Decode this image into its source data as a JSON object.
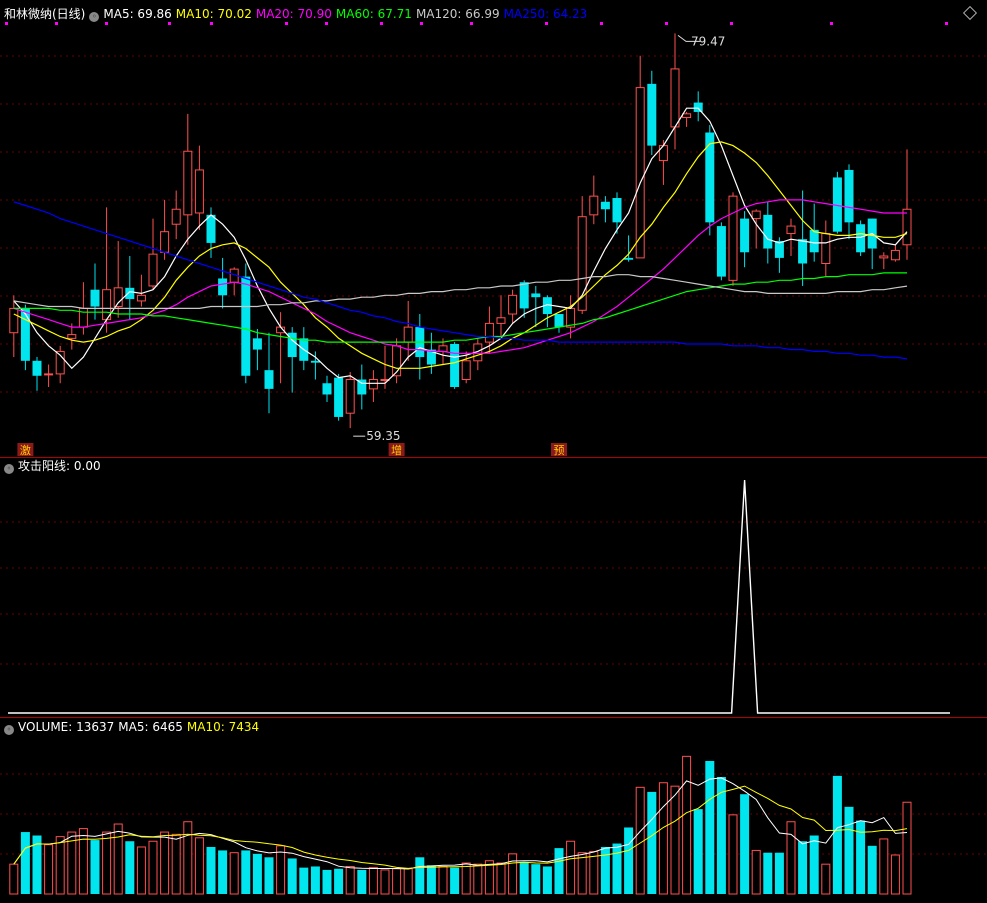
{
  "colors": {
    "up": "#ff5050",
    "down": "#00e5ee",
    "ma5": "#ffffff",
    "ma10": "#ffff00",
    "ma20": "#ff00ff",
    "ma60": "#00ff00",
    "ma120": "#c8c8c8",
    "ma250": "#0000ff",
    "signal": "#ffffff",
    "label_bg": "#8b1a1a",
    "label_fg": "#ffcc00"
  },
  "main": {
    "title": "和林微纳(日线)",
    "ma": [
      {
        "label": "MA5: 69.86",
        "color": "#ffffff"
      },
      {
        "label": "MA10: 70.02",
        "color": "#ffff00"
      },
      {
        "label": "MA20: 70.90",
        "color": "#ff00ff"
      },
      {
        "label": "MA60: 67.71",
        "color": "#00ff00"
      },
      {
        "label": "MA120: 66.99",
        "color": "#c8c8c8"
      },
      {
        "label": "MA250: 64.23",
        "color": "#0000ff"
      }
    ],
    "high_label": "79.47",
    "low_label": "59.35",
    "markers": [
      "激",
      "增",
      "预"
    ]
  },
  "indicator": {
    "title": "攻击阳线",
    "value": ": 0.00"
  },
  "volume": {
    "title": "VOLUME: 13637",
    "ma5": "MA5: 6465",
    "ma10": "MA10: 7434"
  },
  "chart_data": {
    "type": "candlestick",
    "price_range": [
      58.5,
      81.0
    ],
    "candles": [
      [
        64.5,
        65.8,
        63.2,
        66.5
      ],
      [
        65.8,
        63.0,
        62.5,
        66.0
      ],
      [
        63.0,
        62.2,
        61.4,
        63.2
      ],
      [
        62.3,
        62.3,
        61.6,
        62.8
      ],
      [
        62.3,
        63.5,
        61.8,
        63.8
      ],
      [
        64.2,
        64.4,
        63.6,
        65.0
      ],
      [
        64.8,
        65.8,
        64.4,
        67.2
      ],
      [
        66.8,
        65.9,
        65.2,
        68.2
      ],
      [
        65.2,
        66.8,
        64.5,
        71.2
      ],
      [
        65.9,
        66.9,
        65.3,
        69.4
      ],
      [
        66.9,
        66.3,
        65.2,
        68.6
      ],
      [
        66.2,
        66.5,
        65.9,
        67.6
      ],
      [
        67.0,
        68.7,
        66.8,
        70.6
      ],
      [
        68.8,
        69.9,
        68.4,
        71.6
      ],
      [
        70.3,
        71.1,
        69.5,
        72.1
      ],
      [
        70.8,
        74.2,
        69.2,
        76.2
      ],
      [
        70.9,
        73.2,
        70.0,
        74.5
      ],
      [
        70.8,
        69.3,
        68.5,
        71.2
      ],
      [
        67.4,
        66.5,
        65.8,
        68.5
      ],
      [
        67.2,
        67.9,
        66.5,
        68.0
      ],
      [
        67.5,
        62.2,
        61.8,
        68.2
      ],
      [
        64.2,
        63.6,
        62.5,
        64.7
      ],
      [
        62.5,
        61.5,
        60.2,
        64.5
      ],
      [
        64.5,
        64.8,
        61.8,
        65.6
      ],
      [
        64.5,
        63.2,
        61.3,
        64.8
      ],
      [
        64.2,
        63.0,
        62.5,
        64.8
      ],
      [
        63.0,
        62.9,
        62.0,
        63.5
      ],
      [
        61.8,
        61.2,
        60.8,
        62.2
      ],
      [
        62.1,
        60.0,
        59.8,
        62.3
      ],
      [
        60.2,
        62.0,
        59.4,
        62.4
      ],
      [
        62.0,
        61.2,
        60.4,
        62.8
      ],
      [
        61.5,
        62.0,
        60.8,
        62.5
      ],
      [
        62.0,
        62.0,
        61.5,
        63.8
      ],
      [
        62.2,
        63.8,
        61.8,
        64.2
      ],
      [
        64.0,
        64.8,
        63.0,
        66.2
      ],
      [
        64.8,
        63.2,
        62.0,
        65.5
      ],
      [
        63.6,
        62.8,
        62.3,
        64.5
      ],
      [
        63.5,
        63.8,
        62.8,
        64.2
      ],
      [
        63.9,
        61.6,
        61.5,
        64.0
      ],
      [
        62.0,
        63.0,
        61.8,
        63.5
      ],
      [
        63.0,
        63.9,
        62.5,
        64.2
      ],
      [
        64.0,
        65.0,
        63.4,
        65.9
      ],
      [
        65.0,
        65.3,
        64.3,
        66.5
      ],
      [
        65.5,
        66.5,
        65.0,
        66.8
      ],
      [
        67.2,
        65.8,
        65.3,
        67.3
      ],
      [
        66.6,
        66.4,
        64.8,
        67.0
      ],
      [
        66.4,
        65.5,
        64.8,
        66.5
      ],
      [
        65.5,
        64.8,
        64.5,
        65.5
      ],
      [
        64.8,
        65.8,
        64.2,
        66.5
      ],
      [
        65.7,
        70.7,
        65.5,
        71.8
      ],
      [
        70.8,
        71.8,
        70.3,
        72.9
      ],
      [
        71.5,
        71.1,
        70.4,
        71.8
      ],
      [
        71.7,
        70.4,
        69.8,
        72.0
      ],
      [
        68.5,
        68.4,
        68.3,
        69.7
      ],
      [
        68.5,
        77.6,
        68.5,
        79.3
      ],
      [
        77.8,
        74.5,
        74.0,
        78.5
      ],
      [
        73.7,
        74.5,
        72.4,
        74.8
      ],
      [
        75.5,
        78.6,
        74.3,
        80.5
      ],
      [
        76.0,
        76.2,
        75.5,
        76.3
      ],
      [
        76.8,
        76.3,
        75.8,
        77.4
      ],
      [
        75.2,
        70.4,
        69.7,
        75.6
      ],
      [
        70.2,
        67.5,
        67.3,
        70.4
      ],
      [
        67.3,
        71.8,
        67.0,
        72.0
      ],
      [
        70.6,
        68.8,
        68.0,
        71.0
      ],
      [
        70.6,
        71.0,
        69.0,
        71.1
      ],
      [
        70.8,
        69.0,
        68.2,
        71.5
      ],
      [
        69.4,
        68.5,
        67.7,
        69.6
      ],
      [
        69.8,
        70.2,
        68.6,
        70.6
      ],
      [
        69.5,
        68.2,
        67.0,
        72.1
      ],
      [
        70.0,
        68.8,
        68.3,
        71.4
      ],
      [
        68.2,
        69.8,
        67.5,
        70.5
      ],
      [
        72.8,
        69.9,
        69.8,
        73.1
      ],
      [
        73.2,
        70.4,
        69.5,
        73.5
      ],
      [
        70.3,
        68.8,
        68.6,
        70.5
      ],
      [
        70.6,
        69.0,
        67.9,
        70.6
      ],
      [
        68.5,
        68.6,
        67.9,
        68.8
      ],
      [
        68.4,
        68.9,
        68.3,
        69.2
      ],
      [
        69.2,
        71.1,
        68.4,
        74.3
      ]
    ],
    "ma": {
      "MA5": [
        66.2,
        65.5,
        64.5,
        63.8,
        63.3,
        62.6,
        63.2,
        64.2,
        65.2,
        66.1,
        66.7,
        66.6,
        66.8,
        67.5,
        68.6,
        69.5,
        70.2,
        70.8,
        70.3,
        69.6,
        68.4,
        67.0,
        65.8,
        64.8,
        64.1,
        63.6,
        63.2,
        62.6,
        62.1,
        62.2,
        61.8,
        61.8,
        61.8,
        62.4,
        63.2,
        63.7,
        63.5,
        63.3,
        63.2,
        63.3,
        63.5,
        63.8,
        64.2,
        65.0,
        65.5,
        65.8,
        66.0,
        65.9,
        65.8,
        66.5,
        67.8,
        69.0,
        70.0,
        70.9,
        72.5,
        73.8,
        74.5,
        75.5,
        76.5,
        76.5,
        75.8,
        74.5,
        72.9,
        71.3,
        70.3,
        69.5,
        69.3,
        69.5,
        69.4,
        69.3,
        69.3,
        69.5,
        69.6,
        69.6,
        69.8,
        69.3,
        69.2,
        69.9
      ],
      "MA10": [
        65.5,
        65.2,
        64.9,
        64.6,
        64.3,
        64.1,
        64.0,
        64.1,
        64.3,
        64.6,
        64.8,
        65.2,
        65.7,
        66.4,
        67.3,
        68.0,
        68.6,
        69.0,
        69.2,
        69.3,
        69.0,
        68.5,
        68.0,
        67.2,
        66.6,
        66.0,
        65.3,
        64.8,
        64.2,
        63.8,
        63.4,
        63.1,
        62.8,
        62.6,
        62.6,
        62.6,
        62.7,
        62.8,
        62.9,
        63.1,
        63.3,
        63.5,
        63.8,
        64.2,
        64.5,
        64.9,
        65.3,
        65.6,
        65.9,
        66.4,
        67.0,
        67.6,
        68.1,
        68.7,
        69.6,
        70.3,
        71.2,
        72.0,
        73.0,
        73.9,
        74.6,
        74.7,
        74.5,
        74.1,
        73.6,
        72.9,
        72.1,
        71.3,
        70.5,
        69.9,
        69.8,
        69.7,
        69.7,
        69.8,
        69.7,
        69.6,
        69.6,
        69.8
      ],
      "MA20": [
        65.8,
        65.6,
        65.4,
        65.2,
        65.0,
        64.8,
        64.8,
        64.9,
        65.0,
        65.1,
        65.2,
        65.3,
        65.5,
        65.7,
        66.0,
        66.4,
        66.7,
        67.0,
        67.1,
        67.2,
        67.1,
        66.9,
        66.7,
        66.4,
        66.1,
        65.8,
        65.5,
        65.1,
        64.8,
        64.5,
        64.3,
        64.1,
        63.9,
        63.8,
        63.6,
        63.6,
        63.5,
        63.5,
        63.4,
        63.4,
        63.4,
        63.4,
        63.5,
        63.6,
        63.7,
        63.9,
        64.1,
        64.3,
        64.5,
        64.8,
        65.1,
        65.5,
        65.9,
        66.4,
        66.9,
        67.4,
        67.9,
        68.5,
        69.1,
        69.7,
        70.2,
        70.6,
        70.9,
        71.2,
        71.4,
        71.5,
        71.6,
        71.6,
        71.6,
        71.5,
        71.4,
        71.3,
        71.2,
        71.1,
        71.0,
        70.9,
        70.9,
        70.9
      ],
      "MA60": [
        65.8,
        65.8,
        65.8,
        65.8,
        65.7,
        65.7,
        65.6,
        65.6,
        65.6,
        65.5,
        65.5,
        65.5,
        65.4,
        65.4,
        65.3,
        65.2,
        65.1,
        65.0,
        64.9,
        64.8,
        64.7,
        64.5,
        64.4,
        64.3,
        64.2,
        64.1,
        64.1,
        64.0,
        64.0,
        64.0,
        64.0,
        64.0,
        64.0,
        64.0,
        64.0,
        64.0,
        64.0,
        64.0,
        64.1,
        64.1,
        64.2,
        64.3,
        64.3,
        64.4,
        64.5,
        64.6,
        64.7,
        64.8,
        64.9,
        65.0,
        65.2,
        65.3,
        65.5,
        65.7,
        65.9,
        66.1,
        66.3,
        66.5,
        66.7,
        66.8,
        66.9,
        67.0,
        67.1,
        67.1,
        67.2,
        67.2,
        67.3,
        67.3,
        67.4,
        67.4,
        67.5,
        67.5,
        67.6,
        67.6,
        67.6,
        67.7,
        67.7,
        67.7
      ],
      "MA120": [
        66.2,
        66.1,
        66.0,
        65.9,
        65.9,
        65.9,
        65.8,
        65.8,
        65.8,
        65.8,
        65.8,
        65.8,
        65.8,
        65.8,
        65.8,
        65.8,
        65.8,
        65.9,
        65.9,
        65.9,
        65.9,
        65.9,
        66.0,
        66.0,
        66.1,
        66.1,
        66.2,
        66.2,
        66.3,
        66.3,
        66.4,
        66.4,
        66.5,
        66.5,
        66.6,
        66.6,
        66.7,
        66.7,
        66.8,
        66.8,
        66.9,
        66.9,
        67.0,
        67.0,
        67.1,
        67.2,
        67.2,
        67.3,
        67.3,
        67.4,
        67.5,
        67.5,
        67.6,
        67.6,
        67.5,
        67.5,
        67.4,
        67.3,
        67.2,
        67.1,
        67.0,
        66.9,
        66.8,
        66.7,
        66.7,
        66.6,
        66.6,
        66.6,
        66.6,
        66.6,
        66.6,
        66.7,
        66.7,
        66.7,
        66.8,
        66.8,
        66.9,
        66.99
      ],
      "MA250": [
        71.5,
        71.3,
        71.1,
        70.9,
        70.6,
        70.4,
        70.2,
        70.0,
        69.8,
        69.6,
        69.4,
        69.2,
        69.0,
        68.8,
        68.6,
        68.4,
        68.2,
        68.0,
        67.8,
        67.6,
        67.4,
        67.2,
        67.0,
        66.8,
        66.6,
        66.4,
        66.3,
        66.1,
        65.9,
        65.7,
        65.6,
        65.4,
        65.3,
        65.1,
        65.0,
        64.8,
        64.7,
        64.6,
        64.5,
        64.4,
        64.3,
        64.3,
        64.2,
        64.2,
        64.1,
        64.1,
        64.1,
        64.0,
        64.0,
        64.0,
        64.0,
        64.0,
        64.0,
        64.0,
        64.0,
        64.0,
        64.0,
        64.0,
        63.9,
        63.9,
        63.9,
        63.9,
        63.8,
        63.8,
        63.8,
        63.7,
        63.7,
        63.6,
        63.6,
        63.5,
        63.5,
        63.4,
        63.4,
        63.3,
        63.3,
        63.2,
        63.2,
        63.1
      ]
    },
    "signal_spike_index": 63,
    "volume": [
      2600,
      5400,
      5100,
      4300,
      5000,
      5400,
      5700,
      4700,
      5400,
      6100,
      4600,
      4100,
      4600,
      5400,
      5200,
      6300,
      4900,
      4100,
      3800,
      3600,
      3800,
      3500,
      3200,
      4200,
      3100,
      2300,
      2400,
      2100,
      2200,
      2400,
      2100,
      2300,
      2100,
      2200,
      2200,
      3200,
      2500,
      2400,
      2300,
      2700,
      2600,
      2900,
      2700,
      3500,
      2800,
      2600,
      2400,
      4000,
      4600,
      3600,
      3700,
      4100,
      4400,
      5800,
      9300,
      8900,
      9700,
      9400,
      12000,
      7400,
      11600,
      10200,
      6900,
      8700,
      3800,
      3600,
      3600,
      6300,
      4600,
      5100,
      2600,
      10300,
      7600,
      6400,
      4200,
      4800,
      3400,
      8000
    ],
    "volume_range": [
      0,
      13600
    ]
  }
}
